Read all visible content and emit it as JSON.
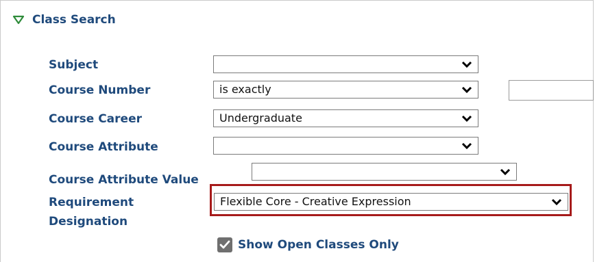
{
  "section": {
    "title": "Class Search",
    "icon": "expanded-triangle-icon"
  },
  "fields": {
    "subject": {
      "label": "Subject",
      "value": ""
    },
    "course_number": {
      "label": "Course Number",
      "operator": "is exactly",
      "value": ""
    },
    "course_career": {
      "label": "Course Career",
      "value": "Undergraduate"
    },
    "course_attribute": {
      "label": "Course Attribute",
      "value": ""
    },
    "course_attribute_value": {
      "label": "Course Attribute Value",
      "value": ""
    },
    "requirement_designation": {
      "label_line1": "Requirement",
      "label_line2": "Designation",
      "value": "Flexible Core - Creative Expression"
    }
  },
  "show_open_classes": {
    "label": "Show Open Classes Only",
    "checked": true
  },
  "colors": {
    "label": "#1f4a7c",
    "highlight": "#a61a1a",
    "triangle": "#2e8b3a",
    "checkbox": "#6f6f6f"
  }
}
